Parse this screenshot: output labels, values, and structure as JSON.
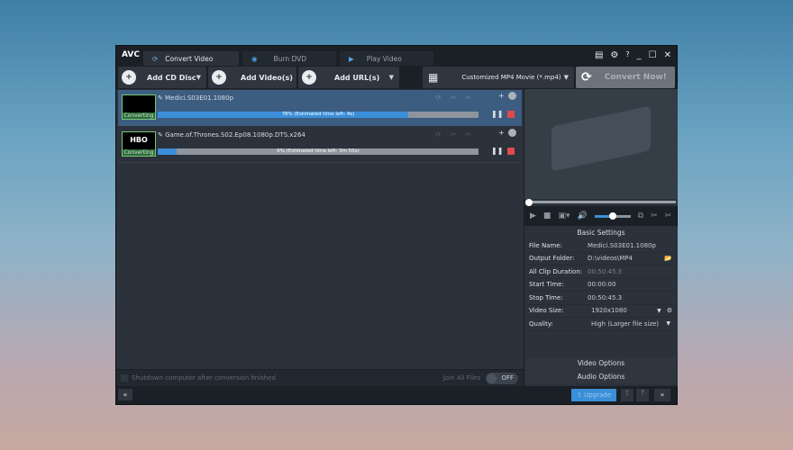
{
  "app": {
    "logo": "AVC"
  },
  "tabs": [
    {
      "label": "Convert Video"
    },
    {
      "label": "Burn DVD"
    },
    {
      "label": "Play Video"
    }
  ],
  "window_controls": {
    "help": "?"
  },
  "toolbar": {
    "add_cd": "Add CD Disc",
    "add_video": "Add Video(s)",
    "add_url": "Add URL(s)",
    "format": "Customized MP4 Movie (*.mp4)",
    "convert": "Convert Now!"
  },
  "files": [
    {
      "name": "Medici.S03E01.1080p",
      "status": "Converting",
      "progress": 78,
      "progress_text": "78% (Estimated time left: 4s)",
      "thumb": ""
    },
    {
      "name": "Game.of.Thrones.S02.Ep08.1080p.DTS.x264",
      "status": "Converting",
      "progress": 6,
      "progress_text": "6% (Estimated time left: 3m 50s)",
      "thumb": "HBO"
    }
  ],
  "footer_list": {
    "shutdown": "Shutdown computer after conversion finished",
    "join": "Join All Files",
    "toggle": "OFF"
  },
  "player": {
    "volume": 0.5,
    "seek": 0
  },
  "settings": {
    "title": "Basic Settings",
    "rows": [
      {
        "k": "File Name:",
        "v": "Medici.S03E01.1080p"
      },
      {
        "k": "Output Folder:",
        "v": "D:\\videos\\MP4"
      },
      {
        "k": "All Clip Duration:",
        "v": "00:50:45.3"
      },
      {
        "k": "Start Time:",
        "v": "00:00:00"
      },
      {
        "k": "Stop Time:",
        "v": "00:50:45.3"
      },
      {
        "k": "Video Size:",
        "v": "1920x1080"
      },
      {
        "k": "Quality:",
        "v": "High (Larger file size)"
      }
    ],
    "video_options": "Video Options",
    "audio_options": "Audio Options"
  },
  "bottom": {
    "upgrade": "Upgrade",
    "collapse": "«",
    "expand": "»"
  }
}
